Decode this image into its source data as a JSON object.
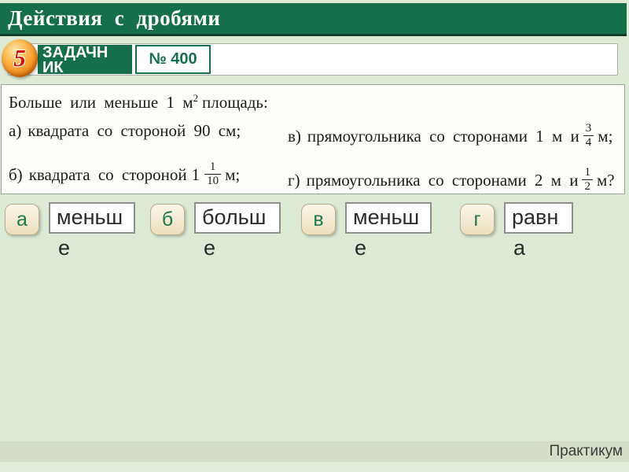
{
  "slide": {
    "title": "Действия с дробями",
    "footer": "Практикум"
  },
  "toolbar": {
    "badge": "5",
    "source_label": "ЗАДАЧНИК",
    "task_number": "№ 400"
  },
  "problem": {
    "intro": {
      "p1": "Больше или меньше 1 м",
      "sup": "2",
      "p2": "площадь:"
    },
    "items": [
      {
        "label": "а)",
        "text": "квадрата со стороной 90 см;"
      },
      {
        "label": "б)",
        "text_before": "квадрата со стороной",
        "whole": "1",
        "frac": {
          "num": "1",
          "den": "10"
        },
        "text_after": "м;"
      },
      {
        "label": "в)",
        "text_before": "прямоугольника со сторонами 1 м и",
        "frac": {
          "num": "3",
          "den": "4"
        },
        "text_after": "м;"
      },
      {
        "label": "г)",
        "text_before": "прямоугольника со сторонами 2 м и",
        "frac": {
          "num": "1",
          "den": "2"
        },
        "text_after": "м?"
      }
    ]
  },
  "answers": [
    {
      "label": "а",
      "value": "меньше",
      "line1": "меньш",
      "line2": "е"
    },
    {
      "label": "б",
      "value": "больше",
      "line1": "больш",
      "line2": "е"
    },
    {
      "label": "в",
      "value": "меньше",
      "line1": "меньш",
      "line2": "е"
    },
    {
      "label": "г",
      "value": "равна",
      "line1": "равн",
      "line2": "а"
    }
  ],
  "colors": {
    "header_green": "#156f4a",
    "background": "#dcead6",
    "footer_band": "#d4ddc7",
    "answer_letter_green": "#1e7a4a",
    "badge_orange": "#ef8d1d",
    "badge_number_red": "#cf1111"
  }
}
